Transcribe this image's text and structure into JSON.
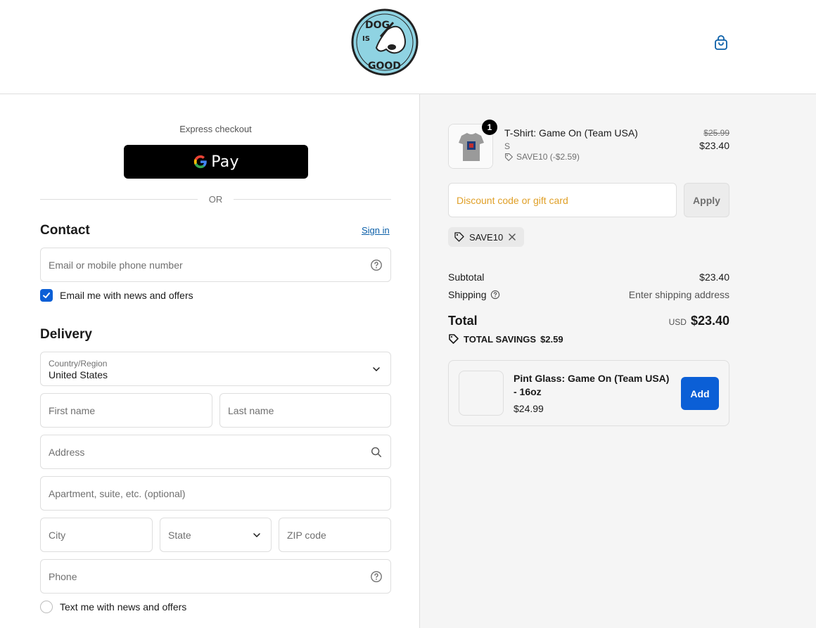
{
  "brand": {
    "logo_top": "DOG",
    "logo_mid": "IS",
    "logo_bottom": "GOOD"
  },
  "express": {
    "label": "Express checkout",
    "gpay_text": "Pay",
    "or_text": "OR"
  },
  "contact": {
    "title": "Contact",
    "signin_label": "Sign in",
    "email_placeholder": "Email or mobile phone number",
    "news_label": "Email me with news and offers",
    "news_checked": true
  },
  "delivery": {
    "title": "Delivery",
    "country_label": "Country/Region",
    "country_value": "United States",
    "first_name_placeholder": "First name",
    "last_name_placeholder": "Last name",
    "address_placeholder": "Address",
    "apartment_placeholder": "Apartment, suite, etc. (optional)",
    "city_placeholder": "City",
    "state_label": "State",
    "zip_placeholder": "ZIP code",
    "phone_placeholder": "Phone",
    "sms_label": "Text me with news and offers",
    "sms_checked": false
  },
  "order": {
    "item": {
      "quantity": "1",
      "title": "T-Shirt: Game On (Team USA)",
      "variant": "S",
      "discount": "SAVE10 (-$2.59)",
      "old_price": "$25.99",
      "price": "$23.40"
    },
    "discount_placeholder": "Discount code or gift card",
    "apply_label": "Apply",
    "applied_code": "SAVE10",
    "subtotal_label": "Subtotal",
    "subtotal_value": "$23.40",
    "shipping_label": "Shipping",
    "shipping_value": "Enter shipping address",
    "total_label": "Total",
    "currency": "USD",
    "total_value": "$23.40",
    "savings_label": "TOTAL SAVINGS",
    "savings_value": "$2.59"
  },
  "upsell": {
    "title": "Pint Glass: Game On (Team USA) - 16oz",
    "price": "$24.99",
    "add_label": "Add"
  },
  "colors": {
    "accent": "#0b5fd6",
    "link": "#0b5fa8",
    "placeholder_warning": "#e0a028"
  }
}
